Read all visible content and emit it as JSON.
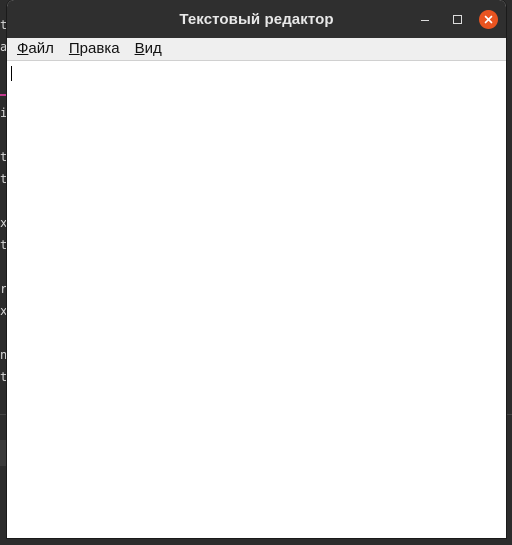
{
  "window": {
    "title": "Текстовый редактор"
  },
  "menu": {
    "items": [
      {
        "mnemonic": "Ф",
        "rest": "айл"
      },
      {
        "mnemonic": "П",
        "rest": "равка"
      },
      {
        "mnemonic": "В",
        "rest": "ид"
      }
    ]
  },
  "editor": {
    "content": ""
  },
  "background_terminal": {
    "lines": [
      "t",
      "a",
      "i",
      "t",
      "t",
      "x",
      "t",
      "r",
      "x",
      "n",
      "t"
    ]
  },
  "colors": {
    "titlebar": "#2f2f2f",
    "close_button": "#e95420",
    "menubar": "#efefef",
    "editor_bg": "#ffffff"
  },
  "icons": {
    "minimize": "minimize-icon",
    "maximize": "maximize-icon",
    "close": "close-icon"
  }
}
